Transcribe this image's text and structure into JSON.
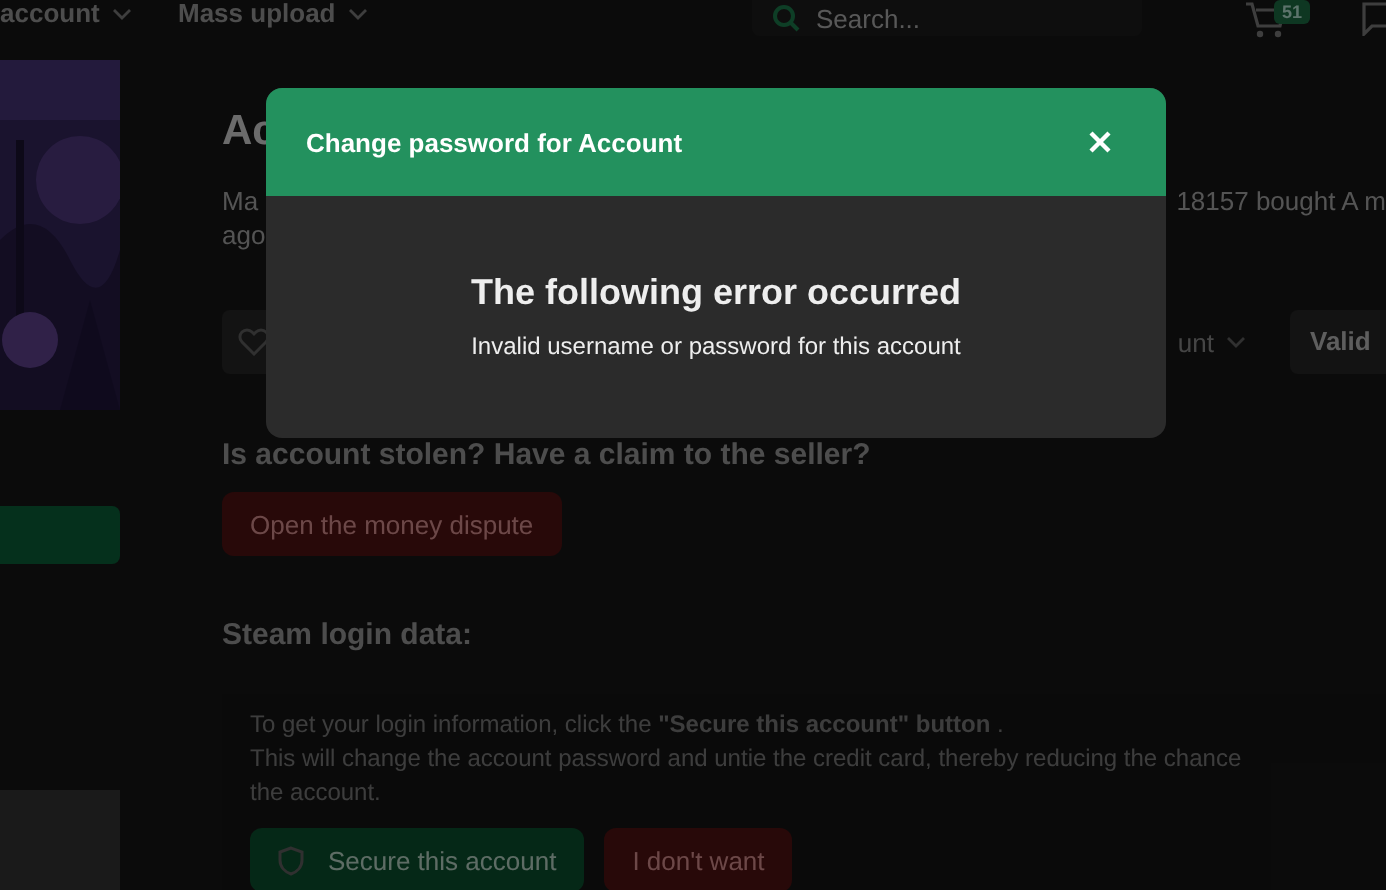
{
  "top_nav": {
    "menus": [
      {
        "label": "account"
      },
      {
        "label": "Mass upload"
      }
    ],
    "search": {
      "placeholder": "Search..."
    },
    "cart_badge": "51"
  },
  "page": {
    "title": "Ac",
    "description_start": "Ma",
    "description_end": "18157 bought A m",
    "description_line_2": "ago",
    "actions": {
      "dropdown": "unt",
      "status": "Valid"
    },
    "claim": {
      "heading": "Is account stolen? Have a claim to the seller?",
      "button": "Open the money dispute"
    },
    "login": {
      "heading": "Steam login data:",
      "lines": [
        "To get your login information, click the **\"Secure this account\" button** .",
        "This will change the account password and untie the credit card, thereby reducing the chance",
        "the account."
      ],
      "buttons": [
        {
          "label": "Secure this account",
          "kind": "secure"
        },
        {
          "label": "I don't want",
          "kind": "decline"
        }
      ]
    }
  },
  "dialog": {
    "title": "Change password for Account",
    "heading": "The following error occurred",
    "message": "Invalid username or password for this account"
  }
}
